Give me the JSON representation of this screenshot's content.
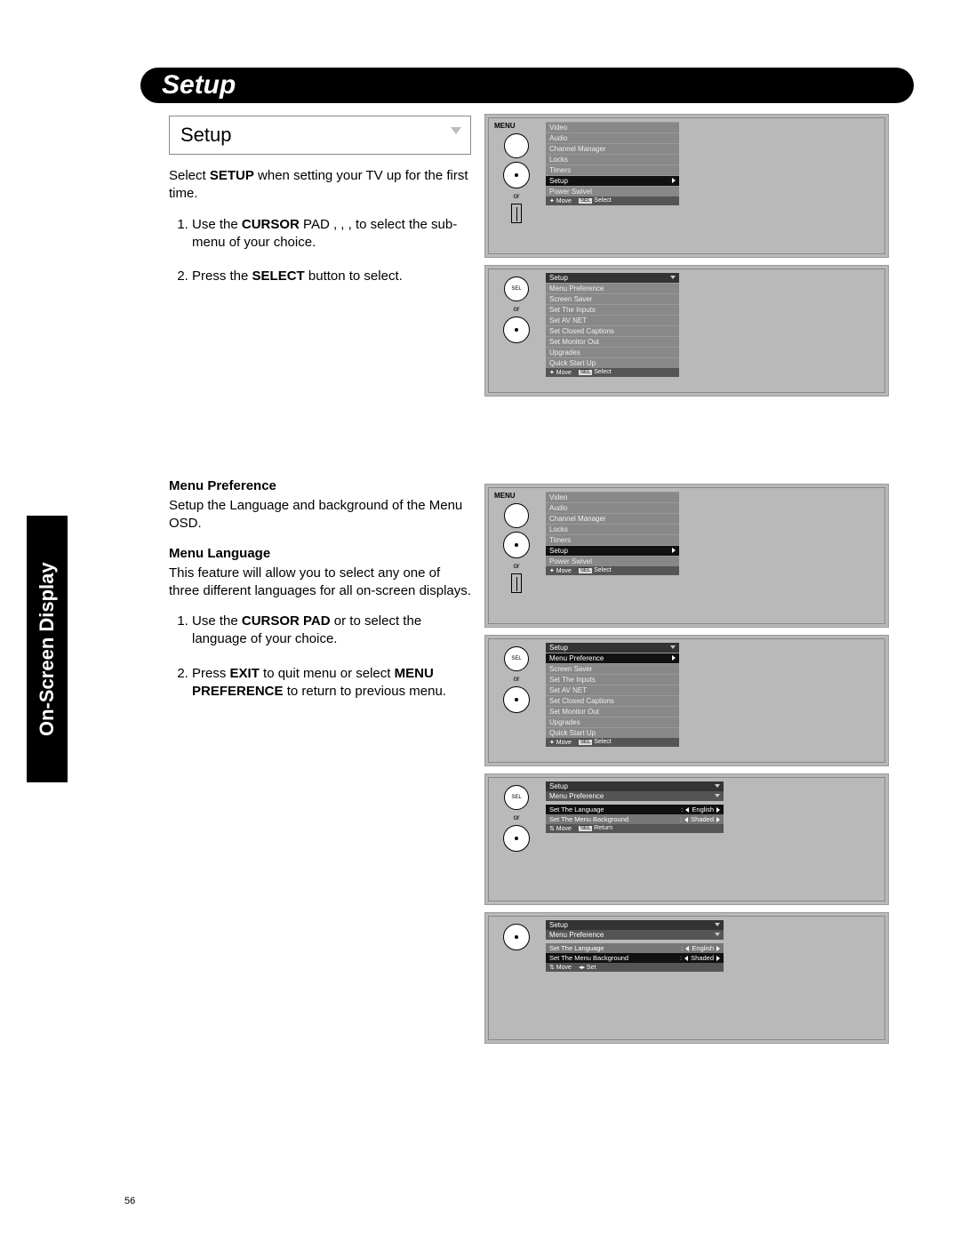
{
  "header": {
    "title": "Setup"
  },
  "sideTab": "On-Screen Display",
  "pageNumber": "56",
  "section1": {
    "title": "Setup",
    "intro_a": "Select ",
    "intro_b": "SETUP",
    "intro_c": " when setting your TV up for the first time.",
    "step1_a": "Use the ",
    "step1_b": "CURSOR",
    "step1_c": " PAD    ,    ,    ,       to select the sub-menu of your choice.",
    "step2_a": "Press the ",
    "step2_b": "SELECT",
    "step2_c": " button to select."
  },
  "section2": {
    "h1": "Menu Preference",
    "p1": "Setup the Language and background of the Menu OSD.",
    "h2": "Menu Language",
    "p2": "This feature will allow you to select any one of three different languages for all on-screen displays.",
    "s1_a": "Use the ",
    "s1_b": "CURSOR PAD",
    "s1_c": "     or     to select the language of your choice.",
    "s2_a": "Press ",
    "s2_b": "EXIT",
    "s2_c": " to quit menu or select ",
    "s2_d": "MENU PREFERENCE",
    "s2_e": " to return to previous menu."
  },
  "remote": {
    "menu": "MENU",
    "or": "or"
  },
  "screens": {
    "mainMenu": {
      "items": [
        "Video",
        "Audio",
        "Channel Manager",
        "Locks",
        "Timers",
        "Setup",
        "Power Swivel"
      ],
      "selected": "Setup",
      "foot_move": "Move",
      "foot_sel": "SEL",
      "foot_select": "Select"
    },
    "setupMenu": {
      "header": "Setup",
      "items": [
        "Menu Preference",
        "Screen Saver",
        "Set The Inputs",
        "Set AV NET",
        "Set Closed Captions",
        "Set Monitor Out",
        "Upgrades",
        "Quick Start Up"
      ],
      "foot_move": "Move",
      "foot_sel": "SEL",
      "foot_select": "Select"
    },
    "setupMenu2_selected": "Menu Preference",
    "prefMenu": {
      "header1": "Setup",
      "header2": "Menu Preference",
      "row1_label": "Set The Language",
      "row1_value": "English",
      "row2_label": "Set The Menu Background",
      "row2_value": "Shaded",
      "foot_move": "Move",
      "foot_sel": "SEL",
      "foot_return": "Return",
      "foot_set": "Set"
    }
  }
}
